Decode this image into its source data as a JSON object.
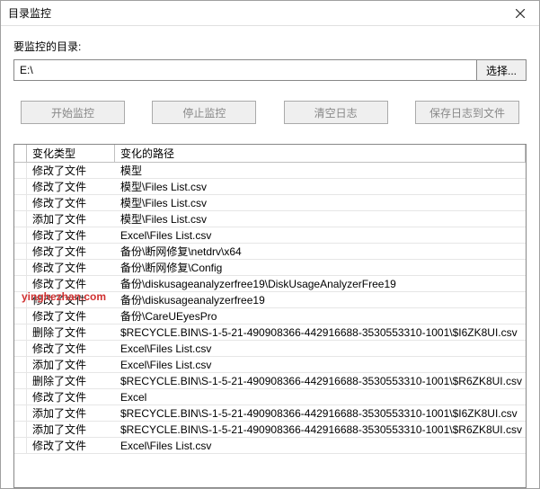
{
  "window": {
    "title": "目录监控",
    "close_icon": "×"
  },
  "labels": {
    "monitor_dir": "要监控的目录:"
  },
  "inputs": {
    "path_value": "E:\\",
    "browse_label": "选择..."
  },
  "buttons": {
    "start": "开始监控",
    "stop": "停止监控",
    "clear": "清空日志",
    "save": "保存日志到文件"
  },
  "columns": {
    "type": "变化类型",
    "path": "变化的路径"
  },
  "rows": [
    {
      "type": "修改了文件",
      "path": "模型"
    },
    {
      "type": "修改了文件",
      "path": "模型\\Files List.csv"
    },
    {
      "type": "修改了文件",
      "path": "模型\\Files List.csv"
    },
    {
      "type": "添加了文件",
      "path": "模型\\Files List.csv"
    },
    {
      "type": "修改了文件",
      "path": "Excel\\Files List.csv"
    },
    {
      "type": "修改了文件",
      "path": "备份\\断网修复\\netdrv\\x64"
    },
    {
      "type": "修改了文件",
      "path": "备份\\断网修复\\Config"
    },
    {
      "type": "修改了文件",
      "path": "备份\\diskusageanalyzerfree19\\DiskUsageAnalyzerFree19"
    },
    {
      "type": "修改了文件",
      "path": "备份\\diskusageanalyzerfree19"
    },
    {
      "type": "修改了文件",
      "path": "备份\\CareUEyesPro"
    },
    {
      "type": "删除了文件",
      "path": "$RECYCLE.BIN\\S-1-5-21-490908366-442916688-3530553310-1001\\$I6ZK8UI.csv"
    },
    {
      "type": "修改了文件",
      "path": "Excel\\Files List.csv"
    },
    {
      "type": "添加了文件",
      "path": "Excel\\Files List.csv"
    },
    {
      "type": "删除了文件",
      "path": "$RECYCLE.BIN\\S-1-5-21-490908366-442916688-3530553310-1001\\$R6ZK8UI.csv"
    },
    {
      "type": "修改了文件",
      "path": "Excel"
    },
    {
      "type": "添加了文件",
      "path": "$RECYCLE.BIN\\S-1-5-21-490908366-442916688-3530553310-1001\\$I6ZK8UI.csv"
    },
    {
      "type": "添加了文件",
      "path": "$RECYCLE.BIN\\S-1-5-21-490908366-442916688-3530553310-1001\\$R6ZK8UI.csv"
    },
    {
      "type": "修改了文件",
      "path": "Excel\\Files List.csv"
    }
  ],
  "watermark": "yinghezhan.com"
}
